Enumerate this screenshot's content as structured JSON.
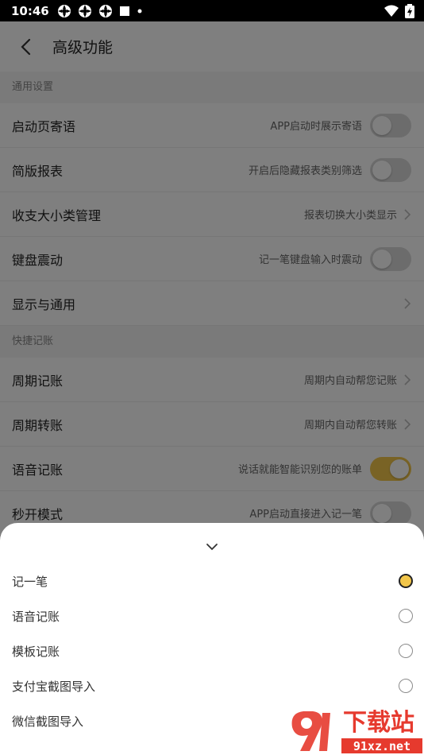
{
  "status_bar": {
    "time": "10:46"
  },
  "header": {
    "title": "高级功能"
  },
  "sections": [
    {
      "title": "通用设置",
      "rows": [
        {
          "label": "启动页寄语",
          "desc": "APP启动时展示寄语",
          "control": "toggle",
          "on": false
        },
        {
          "label": "简版报表",
          "desc": "开启后隐藏报表类别筛选",
          "control": "toggle",
          "on": false
        },
        {
          "label": "收支大小类管理",
          "desc": "报表切换大小类显示",
          "control": "chevron"
        },
        {
          "label": "键盘震动",
          "desc": "记一笔键盘输入时震动",
          "control": "toggle",
          "on": false
        },
        {
          "label": "显示与通用",
          "desc": "",
          "control": "chevron"
        }
      ]
    },
    {
      "title": "快捷记账",
      "rows": [
        {
          "label": "周期记账",
          "desc": "周期内自动帮您记账",
          "control": "chevron"
        },
        {
          "label": "周期转账",
          "desc": "周期内自动帮您转账",
          "control": "chevron"
        },
        {
          "label": "语音记账",
          "desc": "说话就能智能识别您的账单",
          "control": "toggle",
          "on": true
        },
        {
          "label": "秒开模式",
          "desc": "APP启动直接进入记一笔",
          "control": "toggle",
          "on": false
        }
      ]
    }
  ],
  "sheet": {
    "options": [
      {
        "label": "记一笔",
        "selected": true
      },
      {
        "label": "语音记账",
        "selected": false
      },
      {
        "label": "模板记账",
        "selected": false
      },
      {
        "label": "支付宝截图导入",
        "selected": false
      },
      {
        "label": "微信截图导入",
        "selected": false
      }
    ]
  },
  "watermark": {
    "text": "下载站",
    "domain": "91xz.net"
  },
  "colors": {
    "accent": "#f2c64a",
    "overlay": "rgba(0,0,0,0.5)"
  }
}
